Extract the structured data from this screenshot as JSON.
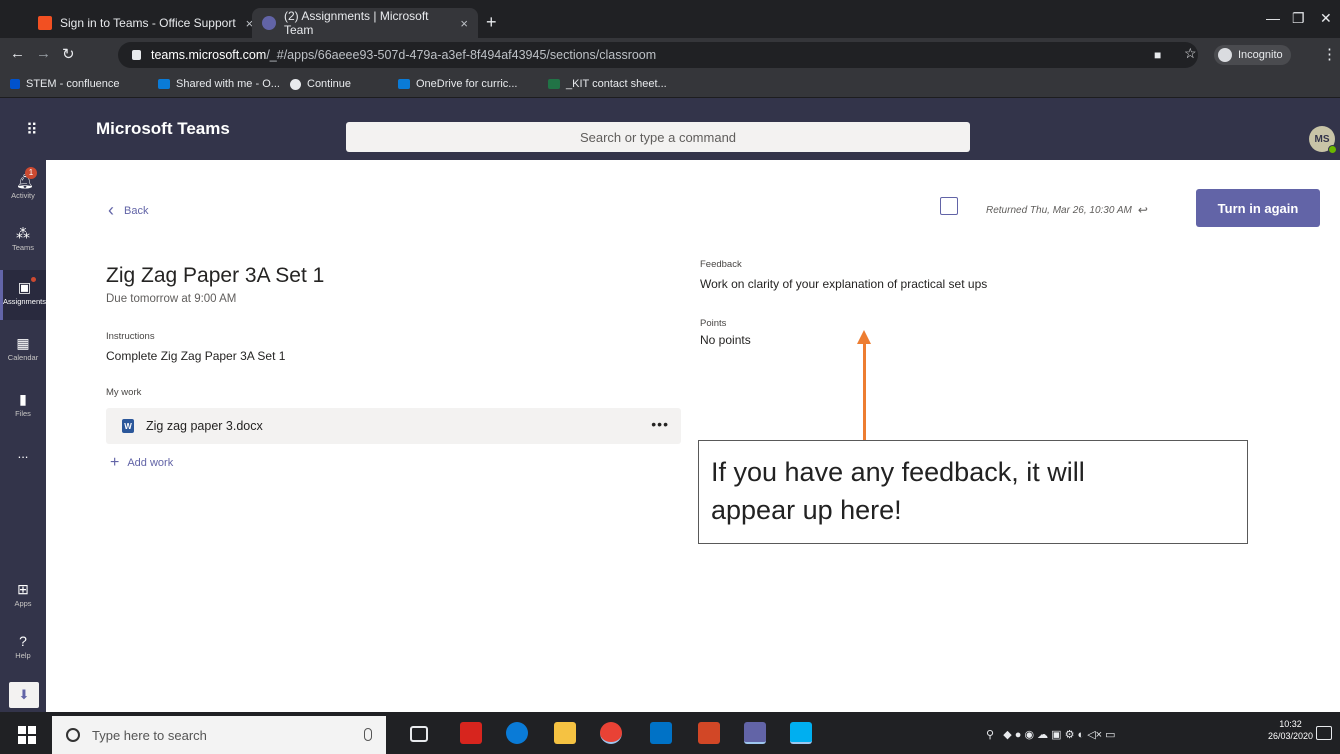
{
  "browser": {
    "tabs": [
      {
        "label": "Sign in to Teams - Office Support",
        "close": "×"
      },
      {
        "label": "(2) Assignments | Microsoft Team",
        "close": "×"
      }
    ],
    "new_tab": "+",
    "url_host": "teams.microsoft.com",
    "url_path": "/_#/apps/66aeee93-507d-479a-a3ef-8f494af43945/sections/classroom",
    "incognito_label": "Incognito",
    "bookmarks": [
      "STEM - confluence",
      "Shared with me - O...",
      "Continue",
      "OneDrive for curric...",
      "_KIT contact sheet..."
    ]
  },
  "teams": {
    "app_name": "Microsoft Teams",
    "search_placeholder": "Search or type a command",
    "avatar_initials": "MS",
    "rail": [
      {
        "label": "Activity",
        "badge": "1"
      },
      {
        "label": "Teams"
      },
      {
        "label": "Assignments"
      },
      {
        "label": "Calendar"
      },
      {
        "label": "Files"
      },
      {
        "label": "..."
      },
      {
        "label": "Apps"
      },
      {
        "label": "Help"
      }
    ]
  },
  "assignment": {
    "back_label": "Back",
    "title": "Zig Zag Paper 3A Set 1",
    "due": "Due tomorrow at 9:00 AM",
    "instructions_label": "Instructions",
    "instructions_text": "Complete Zig Zag Paper 3A  Set 1",
    "my_work_label": "My work",
    "file_name": "Zig zag paper 3.docx",
    "more_label": "•••",
    "add_work_label": "Add work",
    "returned_text": "Returned Thu, Mar 26, 10:30 AM",
    "turn_in_label": "Turn in again",
    "feedback_label": "Feedback",
    "feedback_text": "Work on clarity of your explanation of practical set ups",
    "points_label": "Points",
    "points_text": "No points"
  },
  "callout": {
    "line1": "If you have any feedback, it will",
    "line2": "appear up here!"
  },
  "taskbar": {
    "search_placeholder": "Type here to search",
    "clock_time": "10:32",
    "clock_date": "26/03/2020"
  },
  "colors": {
    "teams_purple": "#6264a7",
    "header_dark": "#33344a",
    "arrow_orange": "#ed7d31"
  }
}
